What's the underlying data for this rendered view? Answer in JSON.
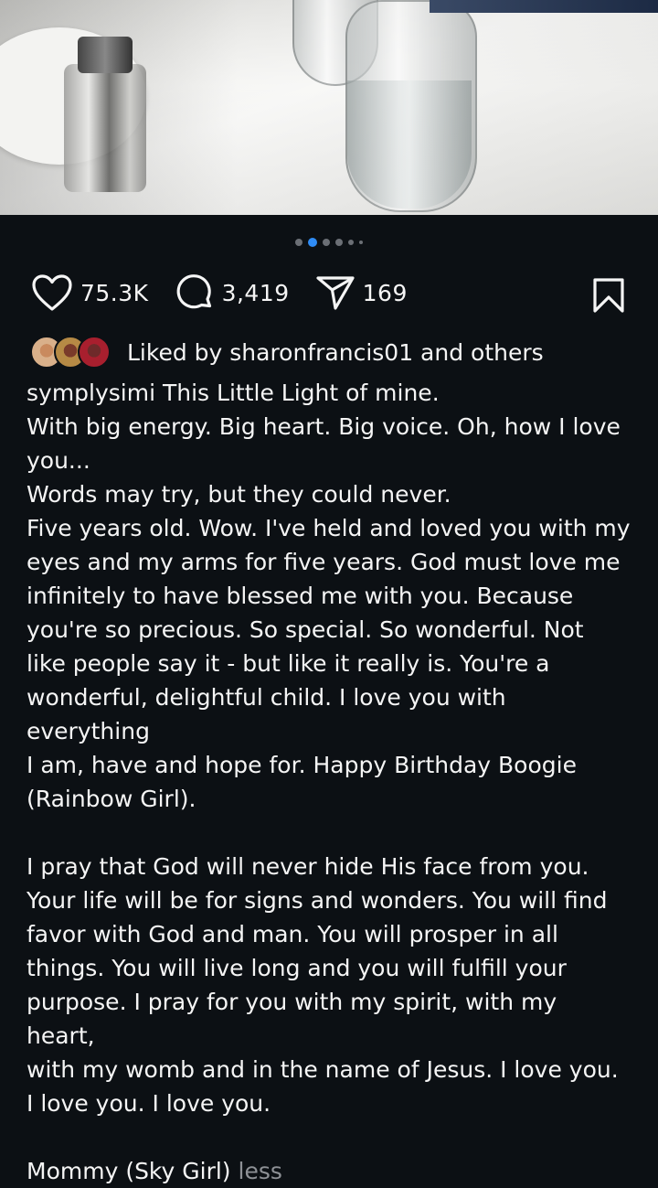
{
  "post": {
    "carousel": {
      "count": 6,
      "active_index": 1
    },
    "actions": {
      "likes": "75.3K",
      "comments": "3,419",
      "shares": "169"
    },
    "liked_by": {
      "text": "Liked by sharonfrancis01 and others"
    },
    "caption": {
      "lines": [
        "symplysimi This Little Light of mine.",
        "With big energy. Big heart. Big voice. Oh, how I love",
        "you...",
        "Words may try, but they could never.",
        "Five years old. Wow. I've held and loved you with my",
        "eyes and my arms for five years. God must love me",
        "infinitely to have blessed me with you. Because",
        "you're so precious. So special. So wonderful. Not",
        "like people say it - but like it really is. You're a",
        "wonderful, delightful child. I love you with everything",
        "I am, have and hope for. Happy Birthday Boogie",
        "(Rainbow Girl).",
        "",
        "I pray that God will never hide His face from you.",
        "Your life will be for signs and wonders. You will find",
        "favor with God and man. You will prosper in all",
        "things. You will live long and you will fulfill your",
        "purpose. I pray for you with my spirit, with my heart,",
        "with my womb and in the name of Jesus. I love you.",
        "I love you. I love you.",
        ""
      ],
      "signoff": "Mommy (Sky Girl)",
      "less_label": "less"
    },
    "icons": [
      "heart-icon",
      "comment-icon",
      "share-icon",
      "bookmark-icon"
    ]
  }
}
